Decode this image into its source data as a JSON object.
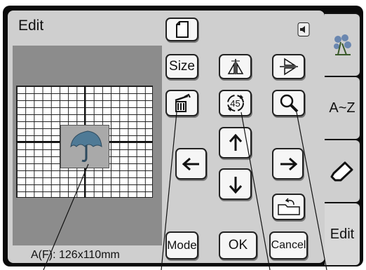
{
  "header": {
    "title": "Edit"
  },
  "toolbar": {
    "size_label": "Size",
    "rotate_label": "45",
    "mode_label": "Mode",
    "ok_label": "OK",
    "cancel_label": "Cancel"
  },
  "status": {
    "area_text": "A(F): 126x110mm"
  },
  "tabs": [
    {
      "label": ""
    },
    {
      "label": "A~Z"
    },
    {
      "label": ""
    },
    {
      "label": "Edit"
    }
  ]
}
